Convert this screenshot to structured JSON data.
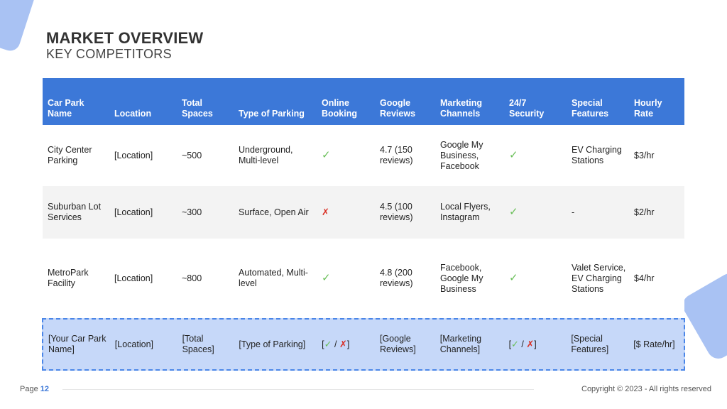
{
  "title": "MARKET OVERVIEW",
  "subtitle": "KEY COMPETITORS",
  "table": {
    "headers": [
      "Car Park Name",
      "Location",
      "Total Spaces",
      "Type of Parking",
      "Online Booking",
      "Google Reviews",
      "Marketing Channels",
      "24/7 Security",
      "Special Features",
      "Hourly Rate"
    ],
    "rows": [
      {
        "name": "City Center Parking",
        "location": "[Location]",
        "spaces": "~500",
        "type": "Underground, Multi-level",
        "online_booking": "✓",
        "reviews": "4.7 (150 reviews)",
        "marketing": "Google My Business, Facebook",
        "security": "✓",
        "features": "EV Charging Stations",
        "rate": "$3/hr"
      },
      {
        "name": "Suburban Lot Services",
        "location": "[Location]",
        "spaces": "~300",
        "type": "Surface, Open Air",
        "online_booking": "✗",
        "reviews": "4.5 (100 reviews)",
        "marketing": "Local Flyers, Instagram",
        "security": "✓",
        "features": "-",
        "rate": "$2/hr"
      },
      {
        "name": "MetroPark Facility",
        "location": "[Location]",
        "spaces": "~800",
        "type": "Automated, Multi-level",
        "online_booking": "✓",
        "reviews": "4.8 (200 reviews)",
        "marketing": "Facebook, Google My Business",
        "security": "✓",
        "features": "Valet Service, EV Charging Stations",
        "rate": "$4/hr"
      },
      {
        "name": "[Your Car Park Name]",
        "location": "[Location]",
        "spaces": "[Total Spaces]",
        "type": "[Type of Parking]",
        "booking_open": "[",
        "booking_yes": "✓",
        "booking_sep": " / ",
        "booking_no": "✗",
        "booking_close": "]",
        "reviews": "[Google Reviews]",
        "marketing": "[Marketing Channels]",
        "security_open": "[",
        "security_yes": "✓",
        "security_sep": " / ",
        "security_no": "✗",
        "security_close": "]",
        "features": "[Special Features]",
        "rate": "[$ Rate/hr]"
      }
    ]
  },
  "footer": {
    "page_label": "Page",
    "page_number": "12",
    "copyright": "Copyright © 2023 - All rights reserved"
  },
  "colors": {
    "header_bg": "#3c78d8",
    "highlight_row_bg": "#c6d8f9",
    "check": "#6abf59",
    "cross": "#d93025",
    "decoration": "#a9c2f3"
  }
}
